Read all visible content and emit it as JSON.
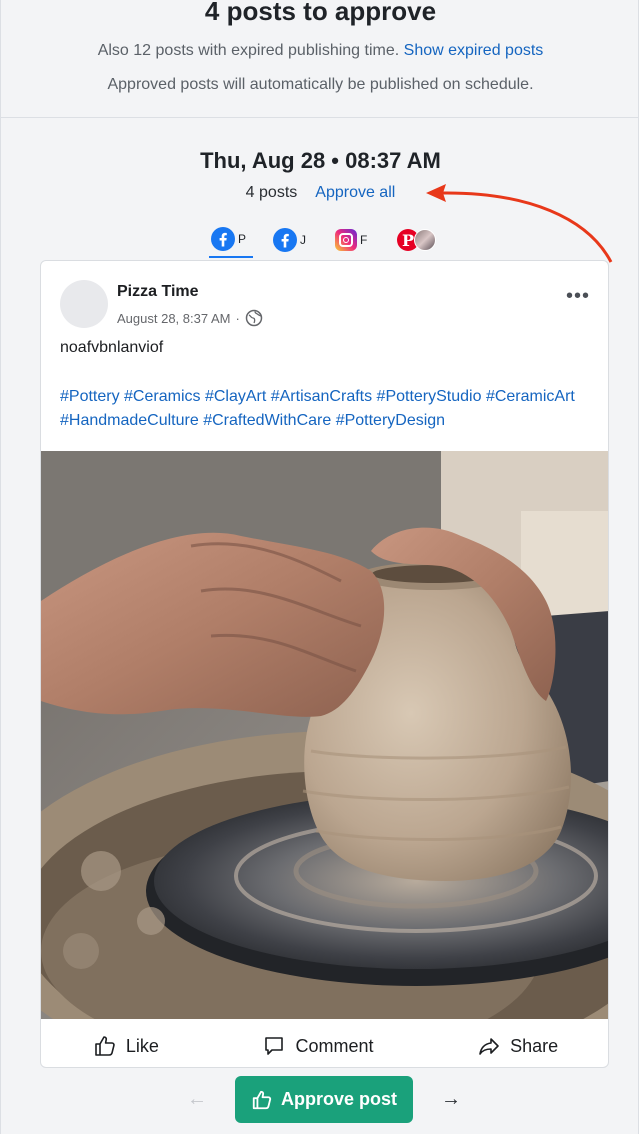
{
  "header": {
    "title": "4 posts to approve",
    "expired_text": "Also 12 posts with expired publishing time.",
    "show_expired_link": "Show expired posts",
    "auto_publish_note": "Approved posts will automatically be published on schedule."
  },
  "schedule": {
    "date_heading": "Thu, Aug 28 • 08:37 AM",
    "post_count": "4 posts",
    "approve_all_label": "Approve all"
  },
  "tabs": [
    {
      "icon": "facebook-icon",
      "label": "P",
      "active": true
    },
    {
      "icon": "facebook-icon",
      "label": "J",
      "active": false
    },
    {
      "icon": "instagram-icon",
      "label": "F",
      "active": false
    },
    {
      "icon": "pinterest-icon",
      "label": "",
      "active": false
    }
  ],
  "post": {
    "page_name": "Pizza Time",
    "timestamp": "August 28, 8:37 AM",
    "meta_separator": "·",
    "visibility_icon": "globe-icon",
    "text": "noafvbnlanviof",
    "hashtags": "#Pottery #Ceramics #ClayArt #ArtisanCrafts #PotteryStudio #CeramicArt #HandmadeCulture #CraftedWithCare #PotteryDesign",
    "image_icon": "pottery-photo",
    "actions": {
      "like": "Like",
      "comment": "Comment",
      "share": "Share"
    }
  },
  "footer": {
    "approve_post_label": "Approve post",
    "prev_arrow": "←",
    "next_arrow": "→"
  },
  "colors": {
    "link": "#1565c0",
    "facebook": "#1877f2",
    "approve_button": "#1aa17b",
    "annotation_arrow": "#e8381a"
  }
}
